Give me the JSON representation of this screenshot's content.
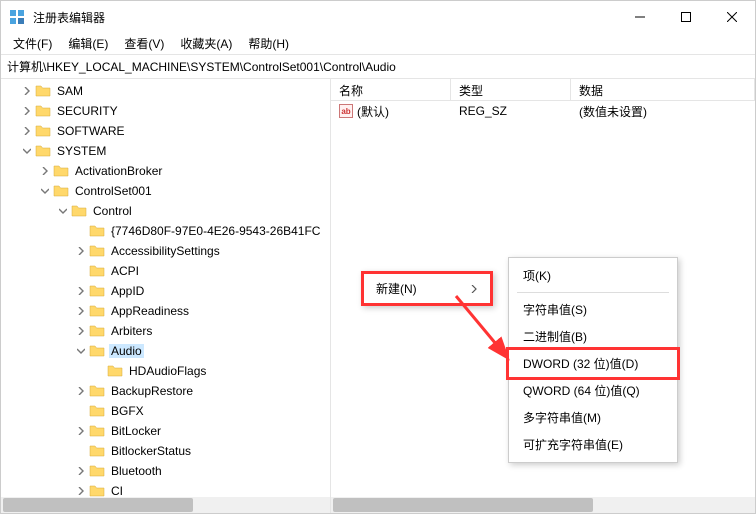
{
  "window": {
    "title": "注册表编辑器"
  },
  "menu": {
    "file": "文件(F)",
    "edit": "编辑(E)",
    "view": "查看(V)",
    "favorites": "收藏夹(A)",
    "help": "帮助(H)"
  },
  "address": "计算机\\HKEY_LOCAL_MACHINE\\SYSTEM\\ControlSet001\\Control\\Audio",
  "tree": [
    {
      "depth": 1,
      "arrow": ">",
      "label": "SAM"
    },
    {
      "depth": 1,
      "arrow": ">",
      "label": "SECURITY"
    },
    {
      "depth": 1,
      "arrow": ">",
      "label": "SOFTWARE"
    },
    {
      "depth": 1,
      "arrow": "v",
      "label": "SYSTEM"
    },
    {
      "depth": 2,
      "arrow": ">",
      "label": "ActivationBroker"
    },
    {
      "depth": 2,
      "arrow": "v",
      "label": "ControlSet001"
    },
    {
      "depth": 3,
      "arrow": "v",
      "label": "Control"
    },
    {
      "depth": 4,
      "arrow": "",
      "label": "{7746D80F-97E0-4E26-9543-26B41FC"
    },
    {
      "depth": 4,
      "arrow": ">",
      "label": "AccessibilitySettings"
    },
    {
      "depth": 4,
      "arrow": "",
      "label": "ACPI"
    },
    {
      "depth": 4,
      "arrow": ">",
      "label": "AppID"
    },
    {
      "depth": 4,
      "arrow": ">",
      "label": "AppReadiness"
    },
    {
      "depth": 4,
      "arrow": ">",
      "label": "Arbiters"
    },
    {
      "depth": 4,
      "arrow": "v",
      "label": "Audio",
      "selected": true
    },
    {
      "depth": 5,
      "arrow": "",
      "label": "HDAudioFlags"
    },
    {
      "depth": 4,
      "arrow": ">",
      "label": "BackupRestore"
    },
    {
      "depth": 4,
      "arrow": "",
      "label": "BGFX"
    },
    {
      "depth": 4,
      "arrow": ">",
      "label": "BitLocker"
    },
    {
      "depth": 4,
      "arrow": "",
      "label": "BitlockerStatus"
    },
    {
      "depth": 4,
      "arrow": ">",
      "label": "Bluetooth"
    },
    {
      "depth": 4,
      "arrow": ">",
      "label": "CI"
    }
  ],
  "columns": {
    "name": "名称",
    "type": "类型",
    "data": "数据"
  },
  "rows": [
    {
      "name": "(默认)",
      "type": "REG_SZ",
      "data": "(数值未设置)"
    }
  ],
  "context": {
    "new": "新建(N)",
    "sub": {
      "key": "项(K)",
      "string": "字符串值(S)",
      "binary": "二进制值(B)",
      "dword": "DWORD (32 位)值(D)",
      "qword": "QWORD (64 位)值(Q)",
      "multi": "多字符串值(M)",
      "expand": "可扩充字符串值(E)"
    }
  }
}
